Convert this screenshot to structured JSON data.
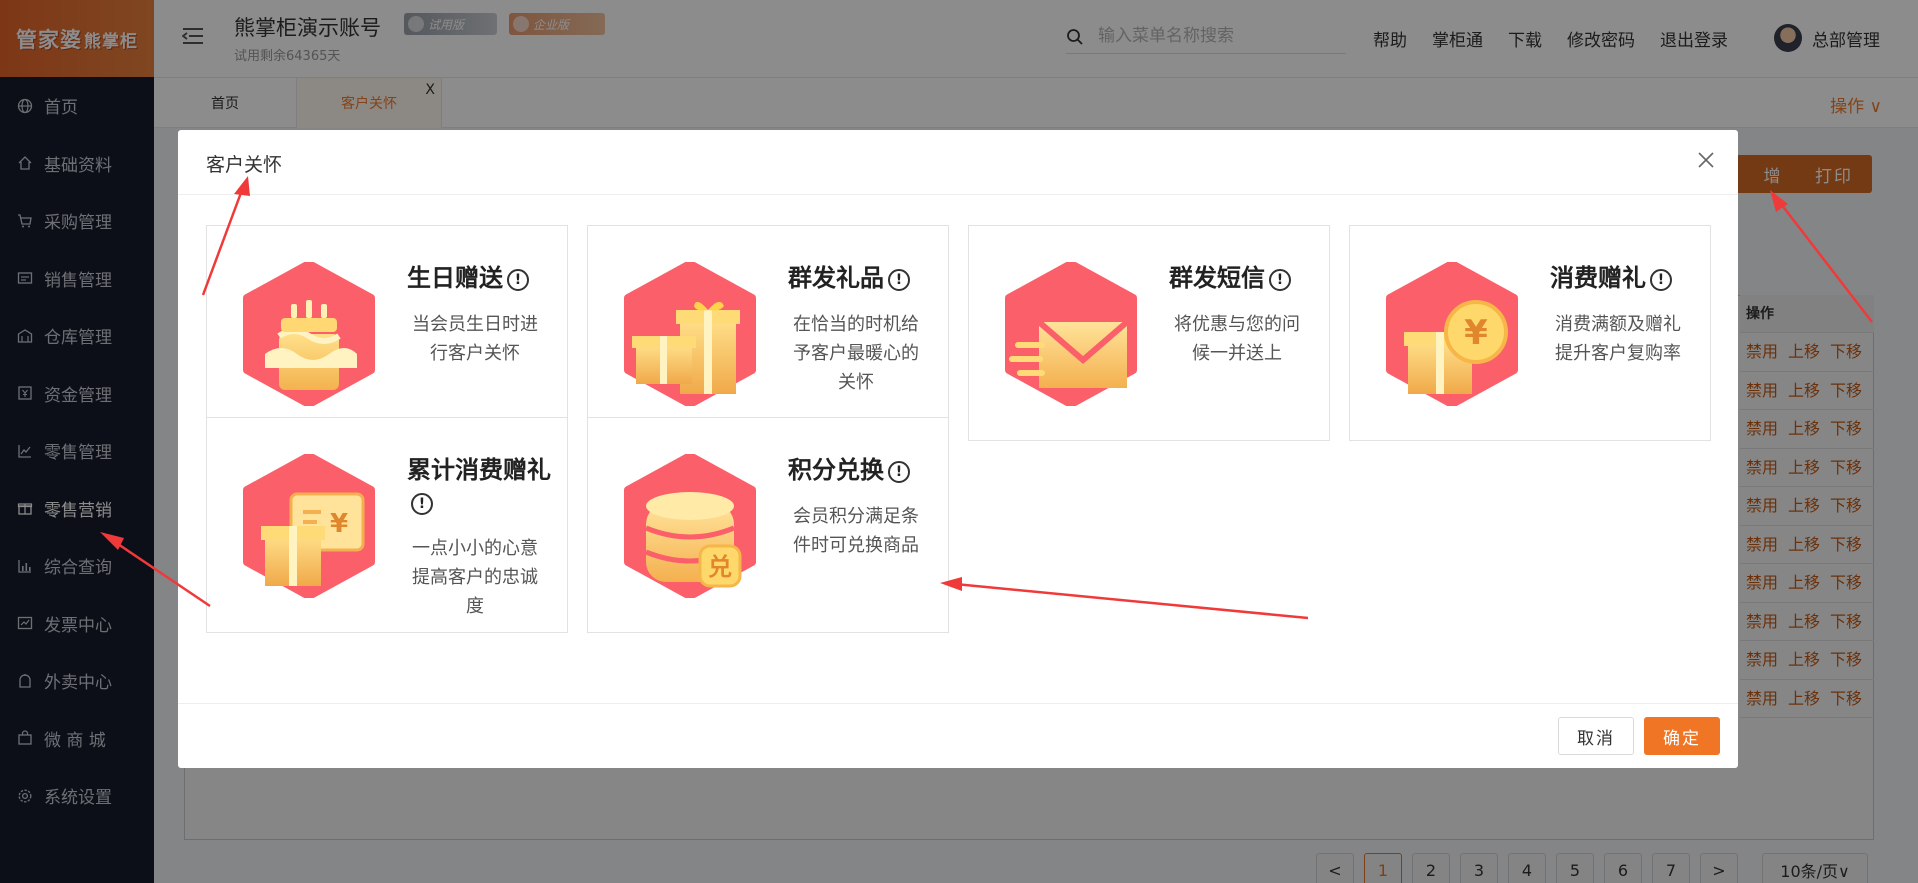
{
  "app": {
    "logo_main": "管家婆",
    "logo_sub": "熊掌柜"
  },
  "header": {
    "account_title": "熊掌柜演示账号",
    "trial_remaining": "试用剩余64365天",
    "badge_trial": "试用版",
    "badge_enterprise": "企业版",
    "search_placeholder": "输入菜单名称搜索",
    "links": [
      "帮助",
      "掌柜通",
      "下载",
      "修改密码",
      "退出登录"
    ],
    "user_name": "总部管理"
  },
  "sidebar": {
    "items": [
      {
        "label": "首页",
        "icon": "globe-icon"
      },
      {
        "label": "基础资料",
        "icon": "home-icon"
      },
      {
        "label": "采购管理",
        "icon": "cart-icon"
      },
      {
        "label": "销售管理",
        "icon": "sales-icon"
      },
      {
        "label": "仓库管理",
        "icon": "warehouse-icon"
      },
      {
        "label": "资金管理",
        "icon": "fund-icon"
      },
      {
        "label": "零售管理",
        "icon": "retail-chart-icon"
      },
      {
        "label": "零售营销",
        "icon": "gift-icon"
      },
      {
        "label": "综合查询",
        "icon": "bar-chart-icon"
      },
      {
        "label": "发票中心",
        "icon": "invoice-icon"
      },
      {
        "label": "外卖中心",
        "icon": "takeout-icon"
      },
      {
        "label": "微 商 城",
        "icon": "shop-bag-icon"
      },
      {
        "label": "系统设置",
        "icon": "gear-icon"
      }
    ]
  },
  "tabs": {
    "home": "首页",
    "active": "客户关怀",
    "close": "X",
    "operations": "操作 ∨"
  },
  "content": {
    "add_button": "增",
    "print_button": "打印",
    "ops_header": "操作",
    "ops_row": [
      "禁用",
      "上移",
      "下移"
    ],
    "pages": [
      "<",
      "1",
      "2",
      "3",
      "4",
      "5",
      "6",
      "7",
      ">"
    ],
    "page_size": "10条/页∨"
  },
  "dialog": {
    "title": "客户关怀",
    "cards": [
      {
        "title": "生日赠送",
        "desc": "当会员生日时进行客户关怀",
        "icon": "birthday-cake-icon"
      },
      {
        "title": "群发礼品",
        "desc": "在恰当的时机给予客户最暖心的关怀",
        "icon": "gift-box-icon"
      },
      {
        "title": "群发短信",
        "desc": "将优惠与您的问候一并送上",
        "icon": "envelope-icon"
      },
      {
        "title": "消费赠礼",
        "desc": "消费满额及赠礼提升客户复购率",
        "icon": "gift-yuan-icon"
      },
      {
        "title": "累计消费赠礼",
        "desc": "一点小小的心意提高客户的忠诚度",
        "icon": "yuan-card-icon"
      },
      {
        "title": "积分兑换",
        "desc": "会员积分满足条件时可兑换商品",
        "icon": "coin-stack-icon"
      }
    ],
    "cancel": "取消",
    "ok": "确定",
    "redeem_char": "兑",
    "yuan": "¥"
  },
  "colors": {
    "accent": "#f07525",
    "sidebar_bg": "#171c2b",
    "hex_red": "#fb5f6a",
    "hex_gold": "#f7c85a"
  }
}
